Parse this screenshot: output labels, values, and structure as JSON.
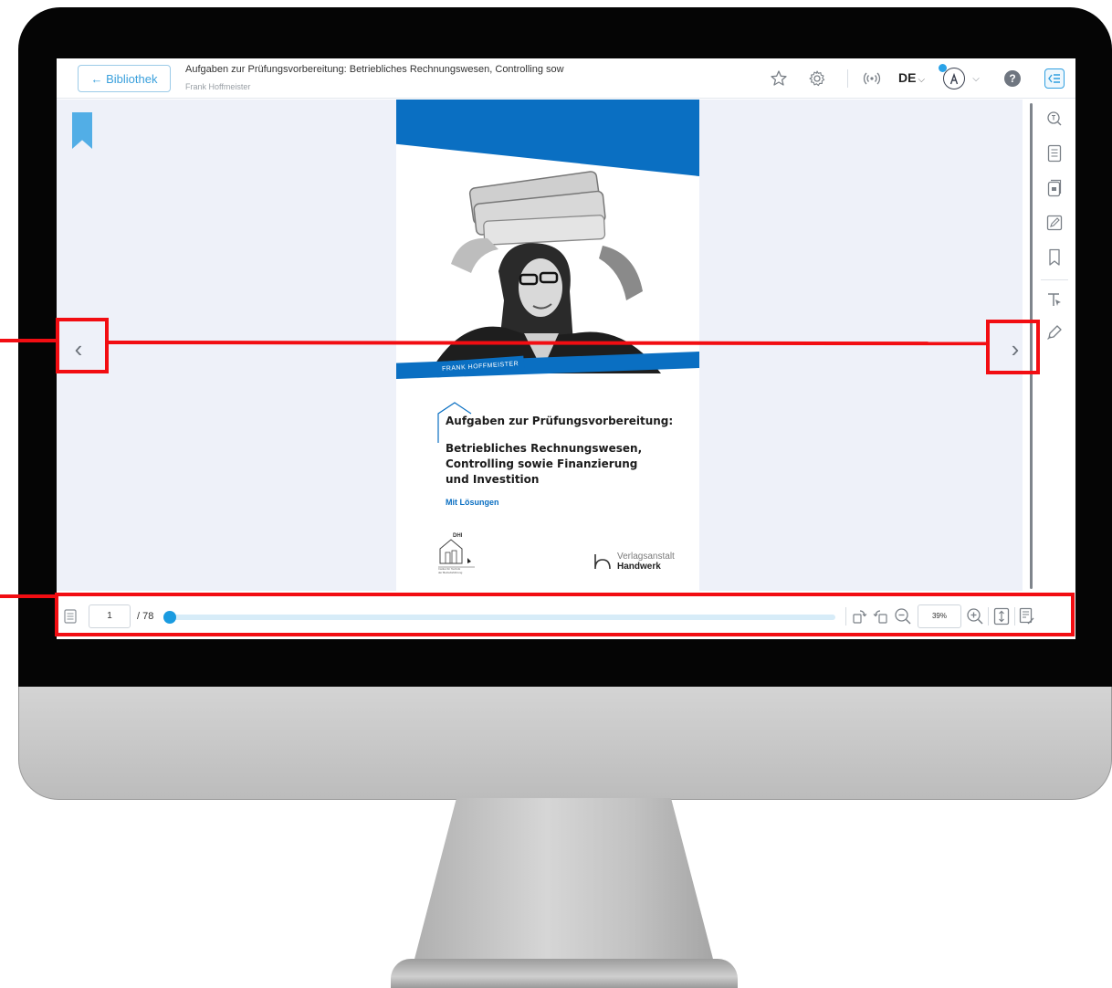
{
  "topbar": {
    "back_label": "← Bibliothek",
    "title": "Aufgaben zur Prüfungsvorbereitung: Betriebliches Rechnungswesen, Controlling sow",
    "author": "Frank Hoffmeister",
    "language": "DE",
    "help_label": "?"
  },
  "navigation": {
    "prev_label": "‹",
    "next_label": "›"
  },
  "cover": {
    "author_tag": "FRANK HOFFMEISTER",
    "title_line1": "Aufgaben zur Prüfungsvorbereitung:",
    "title_line2": "Betriebliches Rechnungswesen,",
    "title_line3": "Controlling sowie Finanzierung",
    "title_line4": "und Investition",
    "subtitle": "Mit Lösungen",
    "dhi_label": "DHI",
    "dhi_caption_1": "Institut für Technik",
    "dhi_caption_2": "der Betriebsführung",
    "publisher_1": "Verlagsanstalt",
    "publisher_2": "Handwerk"
  },
  "pager": {
    "current_page": "1",
    "total_pages": "/ 78",
    "zoom": "39%",
    "progress": 0.01
  },
  "icons": {
    "topbar": [
      "star-icon",
      "gear-icon",
      "broadcast-icon",
      "user-icon",
      "chevron-down-icon",
      "help-icon",
      "panel-toggle-icon"
    ],
    "rail": [
      "search-icon",
      "toc-icon",
      "pages-icon",
      "notes-icon",
      "bookmark-icon",
      "text-select-icon",
      "pen-icon"
    ],
    "bottom": [
      "page-icon",
      "rotate-left-icon",
      "rotate-right-icon",
      "zoom-out-icon",
      "zoom-in-icon",
      "fit-height-icon",
      "text-view-icon"
    ]
  },
  "colors": {
    "accent": "#2aa3e8",
    "cover_blue": "#0a6fc2",
    "annotation_red": "#f20d12",
    "canvas_bg": "#eef1f9"
  }
}
